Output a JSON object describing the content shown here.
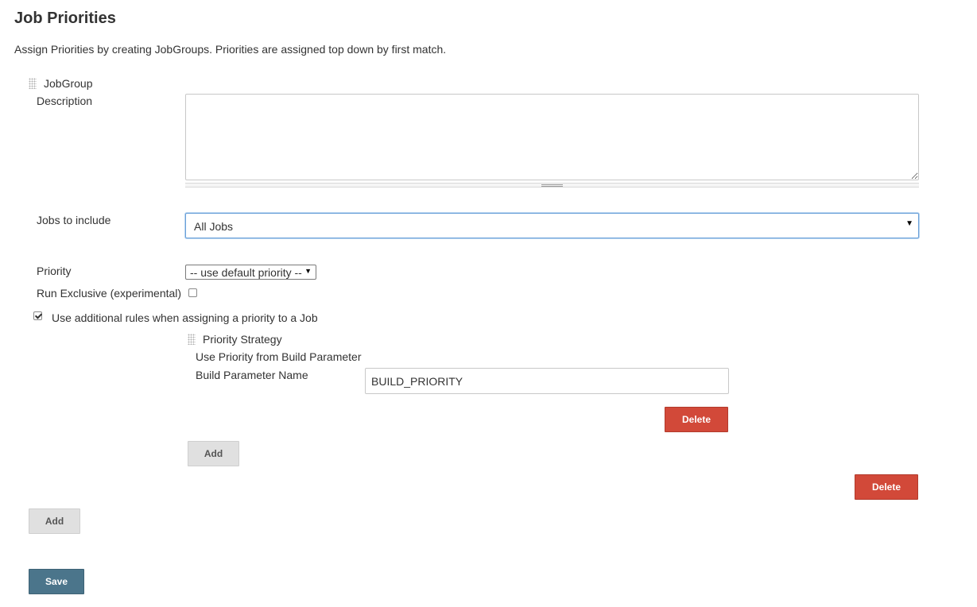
{
  "page": {
    "title": "Job Priorities",
    "intro": "Assign Priorities by creating JobGroups. Priorities are assigned top down by first match."
  },
  "job_group": {
    "header": "JobGroup",
    "description_label": "Description",
    "description_value": "",
    "jobs_to_include_label": "Jobs to include",
    "jobs_to_include_value": "All Jobs",
    "priority_label": "Priority",
    "priority_value": "-- use default priority --",
    "run_exclusive_label": "Run Exclusive (experimental)",
    "run_exclusive_checked": false,
    "additional_rules_label": "Use additional rules when assigning a priority to a Job",
    "additional_rules_checked": true,
    "strategy": {
      "header": "Priority Strategy",
      "type_label": "Use Priority from Build Parameter",
      "param_name_label": "Build Parameter Name",
      "param_name_value": "BUILD_PRIORITY",
      "delete_label": "Delete"
    },
    "add_strategy_label": "Add",
    "delete_label": "Delete"
  },
  "actions": {
    "add_group_label": "Add",
    "save_label": "Save"
  },
  "colors": {
    "delete": "#d24939",
    "save": "#4b758b",
    "add": "#e0e0e0",
    "focus_border": "#6aa0d8"
  }
}
